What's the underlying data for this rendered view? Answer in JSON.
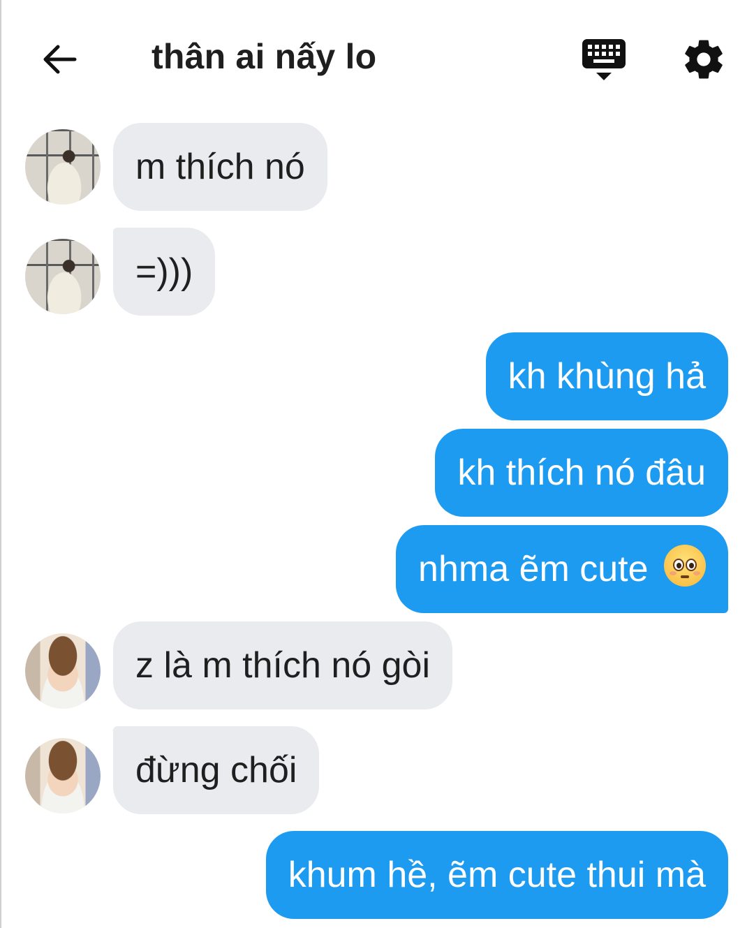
{
  "header": {
    "back_icon": "arrow-left-icon",
    "title": "thân ai nấy lo",
    "keyboard_icon": "keyboard-hide-icon",
    "settings_icon": "gear-icon"
  },
  "messages": [
    {
      "side": "incoming",
      "avatar": "avatar-person-1",
      "text": "m thích nó"
    },
    {
      "side": "incoming",
      "avatar": "avatar-person-1",
      "text": "=)))"
    },
    {
      "side": "outgoing",
      "text": "kh khùng hả"
    },
    {
      "side": "outgoing",
      "text": "kh thích nó đâu"
    },
    {
      "side": "outgoing",
      "text": "nhma ẽm cute",
      "emoji": "pleading-face-icon"
    },
    {
      "side": "incoming",
      "avatar": "avatar-person-2",
      "text": "z là m thích nó gòi"
    },
    {
      "side": "incoming",
      "avatar": "avatar-person-2",
      "text": "đừng chối"
    },
    {
      "side": "outgoing",
      "text": "khum hề, ẽm cute thui mà"
    }
  ],
  "colors": {
    "outgoing_bubble": "#1d9bf0",
    "incoming_bubble": "#e9ebee",
    "text_dark": "#1f1f1f"
  }
}
